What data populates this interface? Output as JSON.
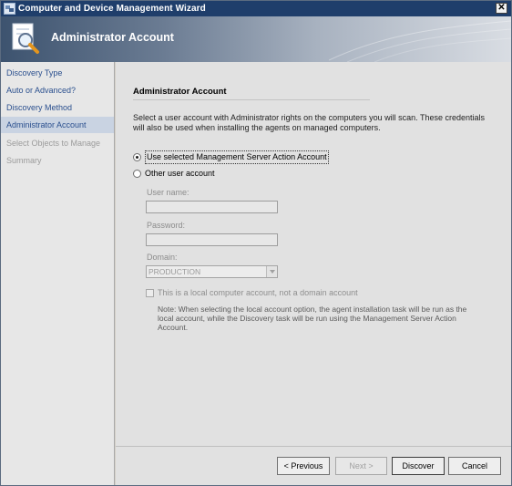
{
  "window": {
    "title": "Computer and Device Management Wizard",
    "close_glyph": "✕"
  },
  "banner": {
    "title": "Administrator Account"
  },
  "sidebar": {
    "items": [
      {
        "label": "Discovery Type"
      },
      {
        "label": "Auto or Advanced?"
      },
      {
        "label": "Discovery Method"
      },
      {
        "label": "Administrator Account"
      },
      {
        "label": "Select Objects to Manage"
      },
      {
        "label": "Summary"
      }
    ]
  },
  "main": {
    "section_title": "Administrator Account",
    "description": "Select a user account with Administrator rights on the computers you will scan. These credentials will also be used when installing the agents on managed computers.",
    "radio_selected": "Use selected Management Server Action Account",
    "radio_other": "Other user account",
    "username_label": "User name:",
    "username_value": "",
    "password_label": "Password:",
    "password_value": "",
    "domain_label": "Domain:",
    "domain_value": "PRODUCTION",
    "local_checkbox": "This is a local computer account, not a domain account",
    "note": "Note:  When selecting the local account option, the agent installation task will be run as the local account, while the Discovery task will be run using the Management Server Action Account."
  },
  "buttons": {
    "previous": "< Previous",
    "next": "Next >",
    "discover": "Discover",
    "cancel": "Cancel"
  },
  "icons": {
    "title": "wizard-icon",
    "banner": "discovery-magnifier-icon",
    "close": "close-icon"
  }
}
